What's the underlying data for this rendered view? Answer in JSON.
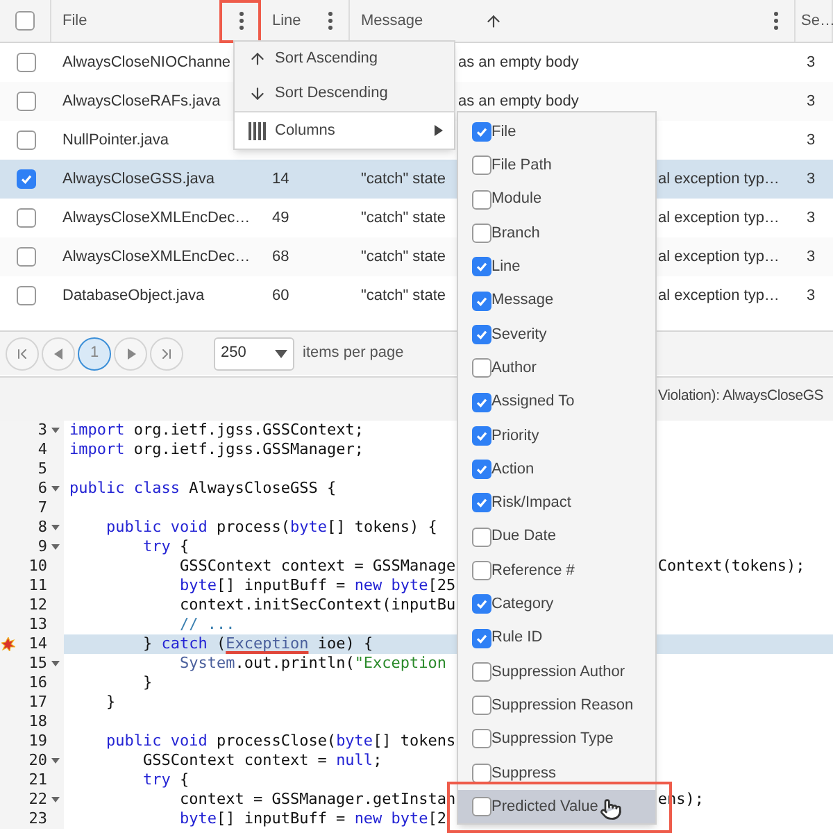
{
  "table": {
    "header_checkbox": {
      "checked": false
    },
    "columns": [
      {
        "label": "File",
        "menu_button": true,
        "highlighted": true
      },
      {
        "label": "Line",
        "menu_button": true,
        "highlighted": false
      },
      {
        "label": "Message",
        "sorted": true,
        "menu_button": true,
        "highlighted": false
      },
      {
        "label": "Se…"
      }
    ],
    "rows": [
      {
        "selected": false,
        "file": "AlwaysCloseNIOChanne",
        "message_tail": "as an empty body",
        "severity": "3"
      },
      {
        "selected": false,
        "file": "AlwaysCloseRAFs.java",
        "message_tail": "as an empty body",
        "severity": "3"
      },
      {
        "selected": false,
        "file": "NullPointer.java",
        "severity": "3"
      },
      {
        "selected": true,
        "file": "AlwaysCloseGSS.java",
        "line": "14",
        "message_head": "\"catch\" state",
        "message_tail": "al exception typ…",
        "severity": "3"
      },
      {
        "selected": false,
        "file": "AlwaysCloseXMLEncDec…",
        "line": "49",
        "message_head": "\"catch\" state",
        "message_tail": "al exception typ…",
        "severity": "3"
      },
      {
        "selected": false,
        "file": "AlwaysCloseXMLEncDec…",
        "line": "68",
        "message_head": "\"catch\" state",
        "message_tail": "al exception typ…",
        "severity": "3"
      },
      {
        "selected": false,
        "file": "DatabaseObject.java",
        "line": "60",
        "message_head": "\"catch\" state",
        "message_tail": "al exception typ…",
        "severity": "3"
      }
    ]
  },
  "pager": {
    "buttons": [
      {
        "kind": "first"
      },
      {
        "kind": "prev"
      },
      {
        "kind": "page",
        "label": "1",
        "selected": true
      },
      {
        "kind": "next"
      },
      {
        "kind": "last"
      }
    ],
    "page_size": "250",
    "page_size_label": "items per page"
  },
  "column_menu": {
    "items": [
      {
        "kind": "sort-asc",
        "label": "Sort Ascending",
        "selected": false
      },
      {
        "kind": "sort-desc",
        "label": "Sort Descending",
        "selected": false
      },
      {
        "kind": "submenu",
        "label": "Columns",
        "expanded": true,
        "selected": true
      }
    ]
  },
  "columns_submenu": {
    "items": [
      {
        "label": "File",
        "checked": true,
        "highlighted": false
      },
      {
        "label": "File Path",
        "checked": false,
        "highlighted": false
      },
      {
        "label": "Module",
        "checked": false,
        "highlighted": false
      },
      {
        "label": "Branch",
        "checked": false,
        "highlighted": false
      },
      {
        "label": "Line",
        "checked": true,
        "highlighted": false
      },
      {
        "label": "Message",
        "checked": true,
        "highlighted": false
      },
      {
        "label": "Severity",
        "checked": true,
        "highlighted": false
      },
      {
        "label": "Author",
        "checked": false,
        "highlighted": false
      },
      {
        "label": "Assigned To",
        "checked": true,
        "highlighted": false
      },
      {
        "label": "Priority",
        "checked": true,
        "highlighted": false
      },
      {
        "label": "Action",
        "checked": true,
        "highlighted": false
      },
      {
        "label": "Risk/Impact",
        "checked": true,
        "highlighted": false
      },
      {
        "label": "Due Date",
        "checked": false,
        "highlighted": false
      },
      {
        "label": "Reference #",
        "checked": false,
        "highlighted": false
      },
      {
        "label": "Category",
        "checked": true,
        "highlighted": false
      },
      {
        "label": "Rule ID",
        "checked": true,
        "highlighted": false
      },
      {
        "label": "Suppression Author",
        "checked": false,
        "highlighted": false
      },
      {
        "label": "Suppression Reason",
        "checked": false,
        "highlighted": false
      },
      {
        "label": "Suppression Type",
        "checked": false,
        "highlighted": false
      },
      {
        "label": "Suppress",
        "checked": false,
        "highlighted": false
      },
      {
        "label": "Predicted Value",
        "checked": false,
        "highlighted": true
      }
    ]
  },
  "details": {
    "title": "Violation): AlwaysCloseGS"
  },
  "code": {
    "lines": [
      {
        "num": "3",
        "fold": true,
        "highlighted": false,
        "segments": [
          {
            "text": "import",
            "kind": "keyword"
          },
          {
            "text": " org.ietf.jgss.GSSContext;",
            "kind": "plain"
          }
        ]
      },
      {
        "num": "4",
        "fold": false,
        "highlighted": false,
        "segments": [
          {
            "text": "import",
            "kind": "keyword"
          },
          {
            "text": " org.ietf.jgss.GSSManager;",
            "kind": "plain"
          }
        ]
      },
      {
        "num": "5",
        "fold": false,
        "highlighted": false
      },
      {
        "num": "6",
        "fold": true,
        "highlighted": false,
        "segments": [
          {
            "text": "public class",
            "kind": "keyword"
          },
          {
            "text": " AlwaysCloseGSS {",
            "kind": "plain"
          }
        ]
      },
      {
        "num": "7",
        "fold": false,
        "highlighted": false
      },
      {
        "num": "8",
        "fold": true,
        "highlighted": false,
        "segments": [
          {
            "text": "    public void",
            "kind": "keyword"
          },
          {
            "text": " process(",
            "kind": "plain"
          },
          {
            "text": "byte",
            "kind": "keyword"
          },
          {
            "text": "[] tokens) {",
            "kind": "plain"
          }
        ]
      },
      {
        "num": "9",
        "fold": true,
        "highlighted": false,
        "segments": [
          {
            "text": "        try",
            "kind": "keyword"
          },
          {
            "text": " {",
            "kind": "plain"
          }
        ]
      },
      {
        "num": "10",
        "fold": false,
        "highlighted": false,
        "segments": [
          {
            "text": "            GSSContext context = GSSManage",
            "kind": "plain"
          }
        ],
        "tail": "Context(tokens);"
      },
      {
        "num": "11",
        "fold": false,
        "highlighted": false,
        "segments": [
          {
            "text": "            byte",
            "kind": "keyword"
          },
          {
            "text": "[] inputBuff = ",
            "kind": "plain"
          },
          {
            "text": "new byte",
            "kind": "keyword"
          },
          {
            "text": "[25",
            "kind": "plain"
          }
        ]
      },
      {
        "num": "12",
        "fold": false,
        "highlighted": false,
        "segments": [
          {
            "text": "            context.initSecContext(inputBu",
            "kind": "plain"
          }
        ]
      },
      {
        "num": "13",
        "fold": false,
        "highlighted": false,
        "segments": [
          {
            "text": "            // ...",
            "kind": "comment"
          }
        ]
      },
      {
        "num": "14",
        "fold": false,
        "highlighted": true,
        "marker": true,
        "segments": [
          {
            "text": "        } ",
            "kind": "plain"
          },
          {
            "text": "catch",
            "kind": "keyword"
          },
          {
            "text": " (",
            "kind": "plain"
          },
          {
            "text": "Exception",
            "kind": "error"
          },
          {
            "text": " ioe) {",
            "kind": "plain"
          }
        ]
      },
      {
        "num": "15",
        "fold": true,
        "highlighted": false,
        "segments": [
          {
            "text": "            System",
            "kind": "type"
          },
          {
            "text": ".out.println(",
            "kind": "plain"
          },
          {
            "text": "\"Exception",
            "kind": "string"
          }
        ]
      },
      {
        "num": "16",
        "fold": false,
        "highlighted": false,
        "segments": [
          {
            "text": "        }",
            "kind": "plain"
          }
        ]
      },
      {
        "num": "17",
        "fold": false,
        "highlighted": false,
        "segments": [
          {
            "text": "    }",
            "kind": "plain"
          }
        ]
      },
      {
        "num": "18",
        "fold": false,
        "highlighted": false
      },
      {
        "num": "19",
        "fold": false,
        "highlighted": false,
        "segments": [
          {
            "text": "    public void",
            "kind": "keyword"
          },
          {
            "text": " processClose(",
            "kind": "plain"
          },
          {
            "text": "byte",
            "kind": "keyword"
          },
          {
            "text": "[] tokens",
            "kind": "plain"
          }
        ]
      },
      {
        "num": "20",
        "fold": true,
        "highlighted": false,
        "segments": [
          {
            "text": "        GSSContext context = ",
            "kind": "plain"
          },
          {
            "text": "null",
            "kind": "keyword"
          },
          {
            "text": ";",
            "kind": "plain"
          }
        ]
      },
      {
        "num": "21",
        "fold": false,
        "highlighted": false,
        "segments": [
          {
            "text": "        try",
            "kind": "keyword"
          },
          {
            "text": " {",
            "kind": "plain"
          }
        ]
      },
      {
        "num": "22",
        "fold": true,
        "highlighted": false,
        "segments": [
          {
            "text": "            context = GSSManager.getInstan",
            "kind": "plain"
          }
        ],
        "tail": "ens);"
      },
      {
        "num": "23",
        "fold": false,
        "highlighted": false,
        "segments": [
          {
            "text": "            byte",
            "kind": "keyword"
          },
          {
            "text": "[] inputBuff = ",
            "kind": "plain"
          },
          {
            "text": "new byte",
            "kind": "keyword"
          },
          {
            "text": "[2",
            "kind": "plain"
          }
        ]
      }
    ]
  }
}
